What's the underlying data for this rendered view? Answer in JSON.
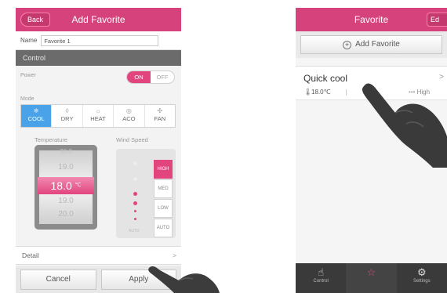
{
  "left_screen": {
    "header": {
      "back_label": "Back",
      "title": "Add Favorite"
    },
    "name_row": {
      "label": "Name",
      "value": "Favorite 1"
    },
    "section_title": "Control",
    "power": {
      "label": "Power",
      "on_label": "ON",
      "off_label": "OFF",
      "state": "on"
    },
    "mode": {
      "label": "Mode",
      "options": [
        {
          "label": "COOL",
          "icon": "snowflake-icon",
          "selected": true
        },
        {
          "label": "DRY",
          "icon": "drop-icon",
          "selected": false
        },
        {
          "label": "HEAT",
          "icon": "sun-icon",
          "selected": false
        },
        {
          "label": "ACO",
          "icon": "auto-icon",
          "selected": false
        },
        {
          "label": "FAN",
          "icon": "fan-icon",
          "selected": false
        }
      ]
    },
    "temperature": {
      "label": "Temperature",
      "above": [
        "30.0",
        "19.0"
      ],
      "value": "18.0",
      "unit": "℃",
      "below": [
        "19.0",
        "20.0"
      ]
    },
    "wind_speed": {
      "label": "Wind Speed",
      "options": [
        {
          "label": "HIGH",
          "selected": true
        },
        {
          "label": "MED",
          "selected": false
        },
        {
          "label": "LOW",
          "selected": false
        },
        {
          "label": "AUTO",
          "selected": false
        }
      ],
      "scale_label": "AUTO"
    },
    "detail": {
      "label": "Detail",
      "chevron": ">"
    },
    "buttons": {
      "cancel": "Cancel",
      "apply": "Apply"
    }
  },
  "right_screen": {
    "header": {
      "title": "Favorite",
      "edit_label": "Ed"
    },
    "add_favorite_label": "Add Favorite",
    "favorites": [
      {
        "name": "Quick cool",
        "temp": "18.0℃",
        "mode_icon": "snowflake-icon",
        "wind": "High",
        "chevron": ">"
      }
    ],
    "tabs": [
      {
        "label": "Control",
        "icon": "hand-icon",
        "active": false
      },
      {
        "label": "Favorite",
        "icon": "star-icon",
        "active": true
      },
      {
        "label": "Settings",
        "icon": "gear-icon",
        "active": false
      }
    ]
  },
  "colors": {
    "accent": "#d6427b",
    "selected_pink": "#e2457e",
    "cool_blue": "#4aa3e8",
    "tabbar": "#3a3a3a"
  }
}
